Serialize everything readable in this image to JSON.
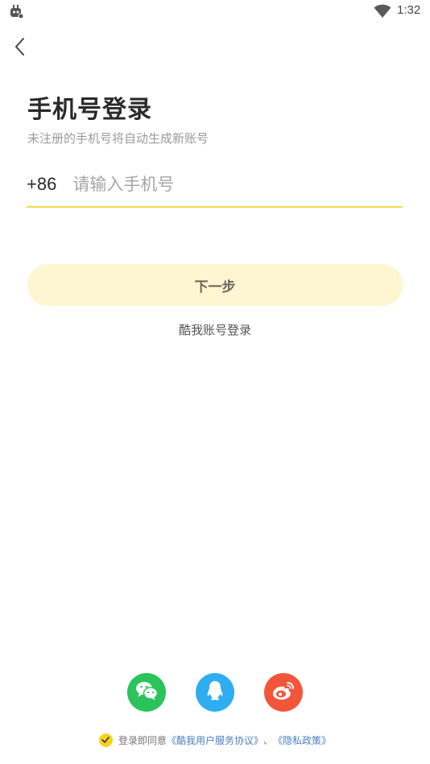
{
  "status_bar": {
    "time": "1:32",
    "app_icon": "robot-notification-icon",
    "wifi_icon": "wifi-icon"
  },
  "nav": {
    "back_icon": "chevron-left-icon"
  },
  "header": {
    "title": "手机号登录",
    "subtitle": "未注册的手机号将自动生成新账号"
  },
  "phone": {
    "country_code": "+86",
    "placeholder": "请输入手机号",
    "value": ""
  },
  "actions": {
    "next_label": "下一步",
    "alt_login_label": "酷我账号登录"
  },
  "social": {
    "items": [
      {
        "name": "wechat",
        "icon": "wechat-icon",
        "color": "#2bc35a"
      },
      {
        "name": "qq",
        "icon": "qq-icon",
        "color": "#2eadf0"
      },
      {
        "name": "weibo",
        "icon": "weibo-icon",
        "color": "#f3553b"
      }
    ]
  },
  "agreement": {
    "prefix": "登录即同意",
    "terms_link": "《酷我用户服务协议》",
    "separator": "、",
    "privacy_link": "《隐私政策》",
    "checked": true
  },
  "colors": {
    "accent": "#f5dc4a",
    "button_bg": "#fdf6d0",
    "link": "#4a7fc1",
    "check": "#f7d21e"
  }
}
